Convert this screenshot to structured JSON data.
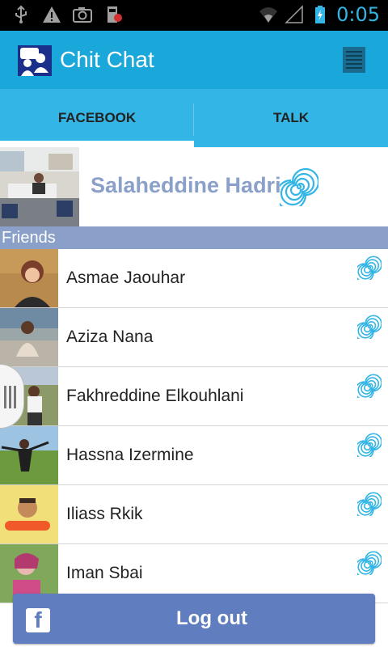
{
  "status_bar": {
    "time": "0:05",
    "icons": [
      "usb-icon",
      "warning-icon",
      "camera-icon",
      "sim-icon",
      "wifi-icon",
      "signal-icon",
      "battery-charging-icon"
    ]
  },
  "action_bar": {
    "title": "Chit Chat",
    "logo_icon": "chit-chat-logo",
    "overflow_icon": "menu-icon"
  },
  "tabs": [
    {
      "label": "FACEBOOK",
      "selected": true
    },
    {
      "label": "TALK",
      "selected": false
    }
  ],
  "profile": {
    "name": "Salaheddine Hadri",
    "status_icon": "spiral-status-icon"
  },
  "friends_section": {
    "header": "Friends",
    "items": [
      {
        "name": "Asmae Jaouhar"
      },
      {
        "name": "Aziza Nana"
      },
      {
        "name": "Fakhreddine Elkouhlani"
      },
      {
        "name": "Hassna Izermine"
      },
      {
        "name": "Iliass Rkik"
      },
      {
        "name": "Iman Sbai"
      }
    ]
  },
  "logout": {
    "label": "Log out",
    "icon": "facebook-icon"
  },
  "colors": {
    "action_bar": "#1aa7d9",
    "tabs": "#33b5e5",
    "section_header": "#8aa0c8",
    "profile_name": "#8aa0c8",
    "logout_button": "#5f7dbf",
    "status_spiral": "#33b5e5"
  }
}
